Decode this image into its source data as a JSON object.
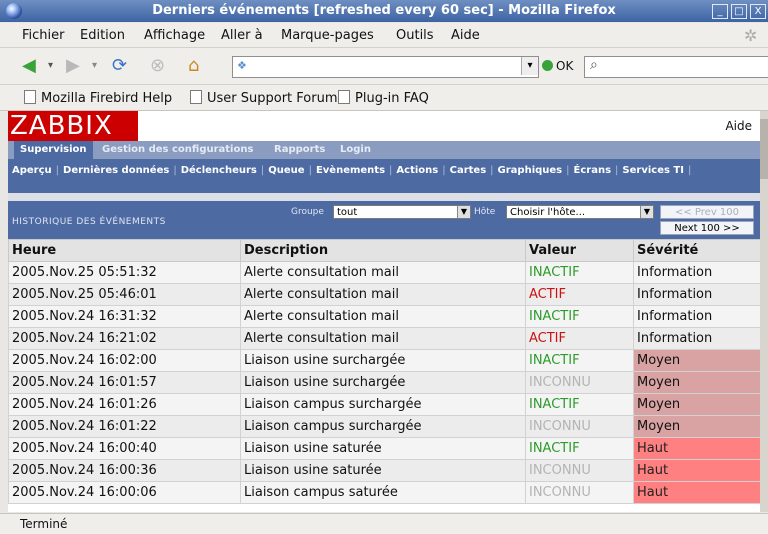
{
  "window": {
    "title": "Derniers événements [refreshed every 60 sec] - Mozilla Firefox",
    "controls": [
      "_",
      "□",
      "X"
    ]
  },
  "menu": [
    "Fichier",
    "Edition",
    "Affichage",
    "Aller à",
    "Marque-pages",
    "Outils",
    "Aide"
  ],
  "toolbar": {
    "go_label": "OK"
  },
  "bookmarks": [
    "Mozilla Firebird Help",
    "User Support Forum",
    "Plug-in FAQ"
  ],
  "app": {
    "logo": "ZABBIX",
    "help": "Aide",
    "top_tabs": [
      "Supervision",
      "Gestion des configurations",
      "Rapports",
      "Login"
    ],
    "active_tab": 0,
    "sub_nav": [
      "Aperçu",
      "Dernières données",
      "Déclencheurs",
      "Queue",
      "Evènements",
      "Actions",
      "Cartes",
      "Graphiques",
      "Écrans",
      "Services TI"
    ]
  },
  "history": {
    "title": "HISTORIQUE DES ÉVÉNEMENTS",
    "group_label": "Groupe",
    "group_value": "tout",
    "host_label": "Hôte",
    "host_value": "Choisir l'hôte...",
    "prev_label": "<< Prev 100",
    "next_label": "Next 100 >>"
  },
  "table": {
    "headers": [
      "Heure",
      "Description",
      "Valeur",
      "Sévérité"
    ],
    "rows": [
      {
        "time": "2005.Nov.25 05:51:32",
        "desc": "Alerte consultation mail",
        "value": "INACTIF",
        "severity": "Information"
      },
      {
        "time": "2005.Nov.25 05:46:01",
        "desc": "Alerte consultation mail",
        "value": "ACTIF",
        "severity": "Information"
      },
      {
        "time": "2005.Nov.24 16:31:32",
        "desc": "Alerte consultation mail",
        "value": "INACTIF",
        "severity": "Information"
      },
      {
        "time": "2005.Nov.24 16:21:02",
        "desc": "Alerte consultation mail",
        "value": "ACTIF",
        "severity": "Information"
      },
      {
        "time": "2005.Nov.24 16:02:00",
        "desc": "Liaison usine surchargée",
        "value": "INACTIF",
        "severity": "Moyen"
      },
      {
        "time": "2005.Nov.24 16:01:57",
        "desc": "Liaison usine surchargée",
        "value": "INCONNU",
        "severity": "Moyen"
      },
      {
        "time": "2005.Nov.24 16:01:26",
        "desc": "Liaison campus surchargée",
        "value": "INACTIF",
        "severity": "Moyen"
      },
      {
        "time": "2005.Nov.24 16:01:22",
        "desc": "Liaison campus surchargée",
        "value": "INCONNU",
        "severity": "Moyen"
      },
      {
        "time": "2005.Nov.24 16:00:40",
        "desc": "Liaison usine saturée",
        "value": "INACTIF",
        "severity": "Haut"
      },
      {
        "time": "2005.Nov.24 16:00:36",
        "desc": "Liaison usine saturée",
        "value": "INCONNU",
        "severity": "Haut"
      },
      {
        "time": "2005.Nov.24 16:00:06",
        "desc": "Liaison campus saturée",
        "value": "INCONNU",
        "severity": "Haut"
      }
    ]
  },
  "status": "Terminé",
  "colors": {
    "inactif": "#2c9b2c",
    "actif": "#cc1111",
    "inconnu": "#b4b4b4",
    "moyen": "#d9a3a3",
    "haut": "#ff8080",
    "zabbix_red": "#cc0000",
    "nav_blue": "#4e6aa3"
  }
}
